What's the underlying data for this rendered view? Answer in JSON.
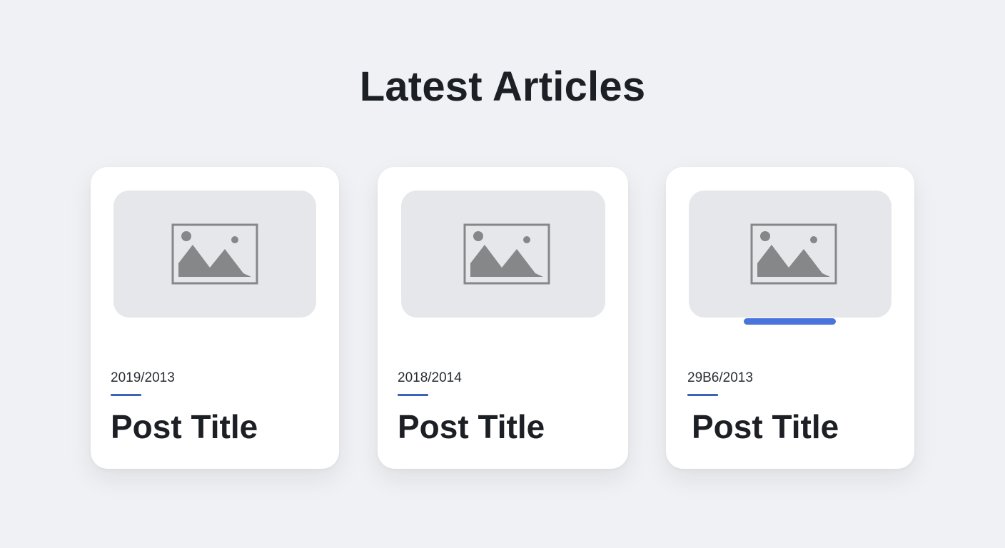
{
  "section": {
    "title": "Latest Articles"
  },
  "articles": [
    {
      "date": "2019/2013",
      "title": "Post Title",
      "thumbnail_icon": "image-placeholder-icon",
      "active": false
    },
    {
      "date": "2018/2014",
      "title": "Post Title",
      "thumbnail_icon": "image-placeholder-icon",
      "active": false
    },
    {
      "date": "29B6/2013",
      "title": "Post Title",
      "thumbnail_icon": "image-placeholder-icon",
      "active": true
    }
  ],
  "colors": {
    "background": "#eff1f4",
    "card": "#ffffff",
    "thumbnail": "#e5e7ea",
    "icon": "#868788",
    "accent": "#3a64b5",
    "active_indicator": "#4a73dc",
    "text": "#1c1f24"
  }
}
